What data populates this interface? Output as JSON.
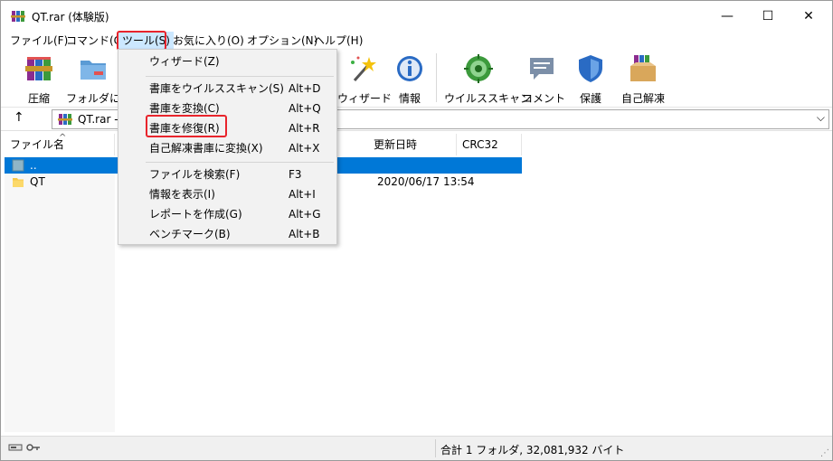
{
  "window": {
    "title": "QT.rar (体験版)"
  },
  "titlebar": {
    "minimize": "—",
    "maximize": "☐",
    "close": "✕"
  },
  "menubar": {
    "items": [
      {
        "id": "file",
        "label": "ファイル(F)"
      },
      {
        "id": "command",
        "label": "コマンド(C)"
      },
      {
        "id": "tools",
        "label": "ツール(S)",
        "active": true
      },
      {
        "id": "favorites",
        "label": "お気に入り(O)"
      },
      {
        "id": "options",
        "label": "オプション(N)"
      },
      {
        "id": "help",
        "label": "ヘルプ(H)"
      }
    ]
  },
  "toolbar": {
    "items": [
      {
        "id": "compress",
        "label": "圧縮",
        "icon": "books-stack-icon"
      },
      {
        "id": "extract-to",
        "label": "フォルダに解",
        "icon": "folder-icon"
      },
      {
        "id": "wizard",
        "label": "ウィザード",
        "icon": "magic-wand-icon"
      },
      {
        "id": "info",
        "label": "情報",
        "icon": "info-icon"
      },
      {
        "id": "virus-scan",
        "label": "ウイルススキャン",
        "icon": "virus-scan-icon"
      },
      {
        "id": "comment",
        "label": "コメント",
        "icon": "comment-icon"
      },
      {
        "id": "protect",
        "label": "保護",
        "icon": "shield-icon"
      },
      {
        "id": "sfx",
        "label": "自己解凍",
        "icon": "sfx-box-icon"
      }
    ]
  },
  "address": {
    "up": "↑",
    "path": "QT.rar - F",
    "chevron": "⌵"
  },
  "list": {
    "columns": [
      {
        "id": "name",
        "label": "ファイル名"
      },
      {
        "id": "modified",
        "label": "更新日時"
      },
      {
        "id": "crc",
        "label": "CRC32"
      }
    ],
    "sort_caret": "^",
    "rows": [
      {
        "name": "..",
        "date": "",
        "type": "parent",
        "selected": true
      },
      {
        "name": "QT",
        "date": "2020/06/17 13:54",
        "type": "folder",
        "selected": false
      }
    ]
  },
  "dropdown": {
    "items": [
      {
        "label": "ウィザード(Z)",
        "shortcut": ""
      },
      {
        "separator": true
      },
      {
        "label": "書庫をウイルススキャン(S)",
        "shortcut": "Alt+D"
      },
      {
        "label": "書庫を変換(C)",
        "shortcut": "Alt+Q"
      },
      {
        "label": "書庫を修復(R)",
        "shortcut": "Alt+R",
        "highlighted": true
      },
      {
        "label": "自己解凍書庫に変換(X)",
        "shortcut": "Alt+X"
      },
      {
        "separator": true
      },
      {
        "label": "ファイルを検索(F)",
        "shortcut": "F3"
      },
      {
        "label": "情報を表示(I)",
        "shortcut": "Alt+I"
      },
      {
        "label": "レポートを作成(G)",
        "shortcut": "Alt+G"
      },
      {
        "label": "ベンチマーク(B)",
        "shortcut": "Alt+B"
      }
    ]
  },
  "status": {
    "text": "合計 1 フォルダ, 32,081,932 バイト"
  },
  "colors": {
    "accent_red": "#e8242c",
    "selection": "#0078d7"
  }
}
